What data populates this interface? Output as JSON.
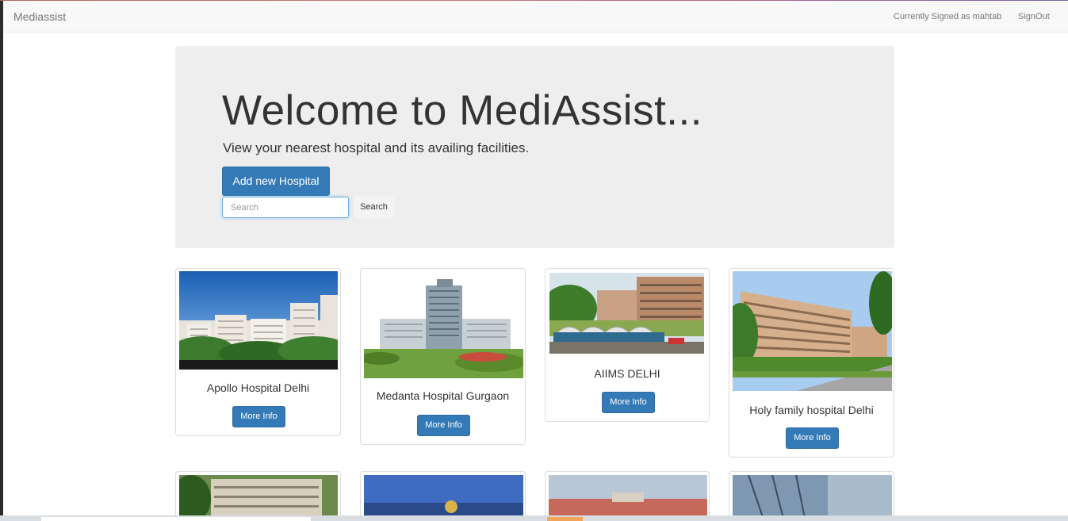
{
  "navbar": {
    "brand": "Mediassist",
    "signed_in_text": "Currently Signed as mahtab",
    "signout_label": "SignOut"
  },
  "hero": {
    "title": "Welcome to MediAssist...",
    "subtitle": "View your nearest hospital and its availing facilities.",
    "add_button_label": "Add new Hospital",
    "search_placeholder": "Search",
    "search_button_label": "Search"
  },
  "hospitals": [
    {
      "name": "Apollo Hospital Delhi",
      "button": "More Info"
    },
    {
      "name": "Medanta Hospital Gurgaon",
      "button": "More Info"
    },
    {
      "name": "AIIMS DELHI",
      "button": "More Info"
    },
    {
      "name": "Holy family hospital Delhi",
      "button": "More Info"
    }
  ],
  "colors": {
    "primary": "#337ab7",
    "jumbotron_bg": "#eeeeee",
    "navbar_bg": "#f8f8f8"
  }
}
